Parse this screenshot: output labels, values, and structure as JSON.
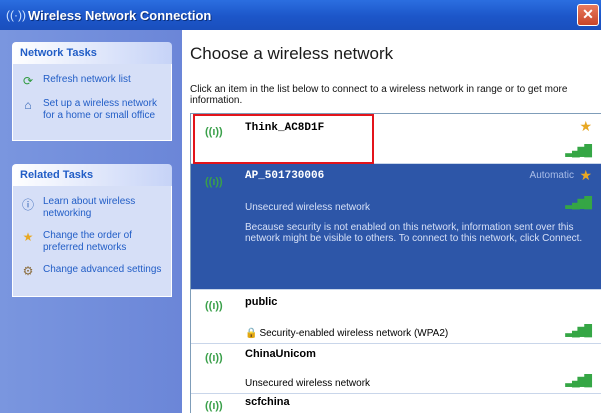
{
  "window": {
    "title": "Wireless Network Connection",
    "title_icon": "((·))",
    "close_label": "✕"
  },
  "network_tasks": {
    "header": "Network Tasks",
    "items": [
      {
        "label": "Refresh network list",
        "icon": "refresh-icon"
      },
      {
        "label": "Set up a wireless network for a home or small office",
        "icon": "setup-icon"
      }
    ]
  },
  "related_tasks": {
    "header": "Related Tasks",
    "items": [
      {
        "label": "Learn about wireless networking",
        "icon": "info-icon"
      },
      {
        "label": "Change the order of preferred networks",
        "icon": "star-icon"
      },
      {
        "label": "Change advanced settings",
        "icon": "settings-icon"
      }
    ]
  },
  "main": {
    "heading": "Choose a wireless network",
    "instructions": "Click an item in the list below to connect to a wireless network in range or to get more information."
  },
  "networks": [
    {
      "ssid": "Think_AC8D1F",
      "security": "",
      "status": "",
      "signal": "▂▄▆█",
      "starred": true
    },
    {
      "ssid": "AP_501730006",
      "security": "Unsecured wireless network",
      "status": "Automatic",
      "description": "Because security is not enabled on this network, information sent over this network might be visible to others. To connect to this network, click Connect.",
      "signal": "▂▄▆█",
      "starred": true
    },
    {
      "ssid": "public",
      "security": "Security-enabled wireless network (WPA2)",
      "signal": "▂▄▆█"
    },
    {
      "ssid": "ChinaUnicom",
      "security": "Unsecured wireless network",
      "signal": "▂▄▆█"
    },
    {
      "ssid": "scfchina",
      "security": "",
      "signal": ""
    }
  ],
  "icons": {
    "antenna": "((ı))",
    "star": "★",
    "lock": "🔒"
  },
  "colors": {
    "titlebar": "#1c56c9",
    "selected_row": "#2d56a8",
    "highlight_box": "#e3141b",
    "task_link": "#215dc6"
  }
}
